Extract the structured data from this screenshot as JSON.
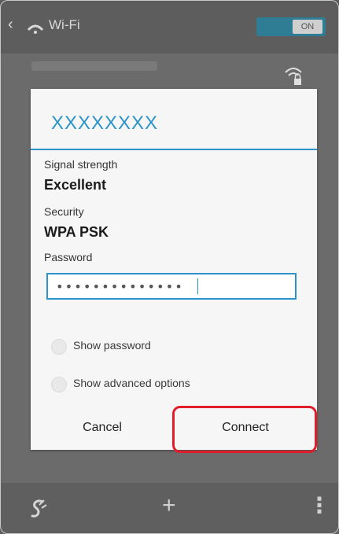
{
  "action_bar": {
    "title": "Wi-Fi",
    "toggle_label": "ON"
  },
  "dialog": {
    "network_name": "XXXXXXXX",
    "signal_label": "Signal strength",
    "signal_value": "Excellent",
    "security_label": "Security",
    "security_value": "WPA PSK",
    "password_label": "Password",
    "password_value": "••••••••••••••",
    "show_password_label": "Show password",
    "show_advanced_label": "Show advanced options",
    "cancel_label": "Cancel",
    "connect_label": "Connect"
  },
  "bottom_bar": {
    "add_label": "+",
    "more_label": "⋮"
  },
  "colors": {
    "accent": "#2a93c7",
    "highlight": "#e11d2a",
    "overlay": "#6b6b6b"
  },
  "icons": [
    "back-icon",
    "wifi-app-icon",
    "wifi-lock-icon",
    "wps-icon",
    "add-icon",
    "more-icon"
  ]
}
